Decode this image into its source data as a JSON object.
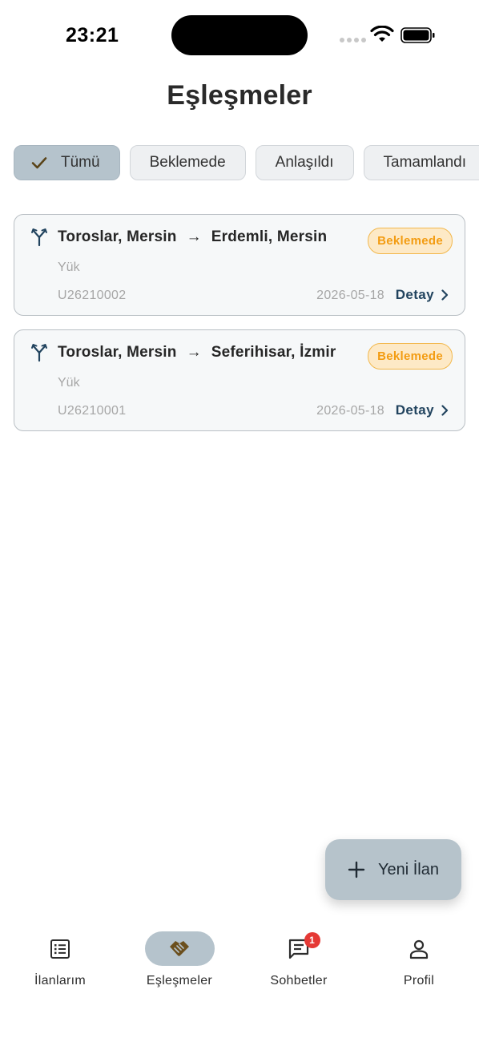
{
  "status_bar": {
    "time": "23:21"
  },
  "header": {
    "title": "Eşleşmeler"
  },
  "filters": [
    {
      "label": "Tümü",
      "selected": true
    },
    {
      "label": "Beklemede",
      "selected": false
    },
    {
      "label": "Anlaşıldı",
      "selected": false
    },
    {
      "label": "Tamamlandı",
      "selected": false
    }
  ],
  "matches": [
    {
      "from": "Toroslar, Mersin",
      "arrow": "→",
      "to": "Erdemli, Mersin",
      "status": "Beklemede",
      "type": "Yük",
      "code": "U26210002",
      "date": "2026-05-18",
      "detail_label": "Detay"
    },
    {
      "from": "Toroslar, Mersin",
      "arrow": "→",
      "to": "Seferihisar, İzmir",
      "status": "Beklemede",
      "type": "Yük",
      "code": "U26210001",
      "date": "2026-05-18",
      "detail_label": "Detay"
    }
  ],
  "fab": {
    "label": "Yeni İlan"
  },
  "bottom_nav": {
    "items": [
      {
        "label": "İlanlarım",
        "icon": "list-icon",
        "active": false
      },
      {
        "label": "Eşleşmeler",
        "icon": "handshake-icon",
        "active": true
      },
      {
        "label": "Sohbetler",
        "icon": "chat-icon",
        "active": false,
        "badge": "1"
      },
      {
        "label": "Profil",
        "icon": "person-icon",
        "active": false
      }
    ]
  },
  "colors": {
    "accent": "#b5c3cc",
    "status_pending_text": "#f39c12",
    "status_pending_bg": "#fde9c6",
    "link": "#21435e",
    "badge": "#e53935"
  }
}
